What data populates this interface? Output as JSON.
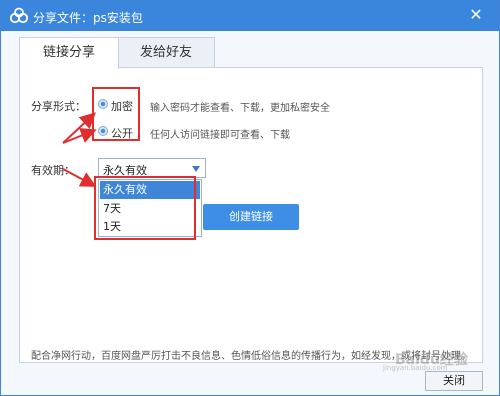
{
  "titlebar": {
    "title": "分享文件：ps安装包",
    "close_label": "✕"
  },
  "tabs": [
    {
      "label": "链接分享"
    },
    {
      "label": "发给好友"
    }
  ],
  "share_form": {
    "label": "分享形式：",
    "options": [
      {
        "label": "加密",
        "hint": "输入密码才能查看、下载，更加私密安全"
      },
      {
        "label": "公开",
        "hint": "任何人访问链接即可查看、下载"
      }
    ]
  },
  "validity": {
    "label": "有效期：",
    "selected": "永久有效",
    "options": [
      "永久有效",
      "7天",
      "1天"
    ]
  },
  "create_button": "创建链接",
  "notice": "配合净网行动，百度网盘严厉打击不良信息、色情低俗信息的传播行为，如经发现，或将封号处理。",
  "close_button": "关闭",
  "watermark": {
    "text": "Baidu经验",
    "sub": "jingyan.baidu.com"
  },
  "colors": {
    "titlebar": "#3a86dc",
    "accent": "#3f86d8",
    "highlight": "#e02e2e"
  }
}
